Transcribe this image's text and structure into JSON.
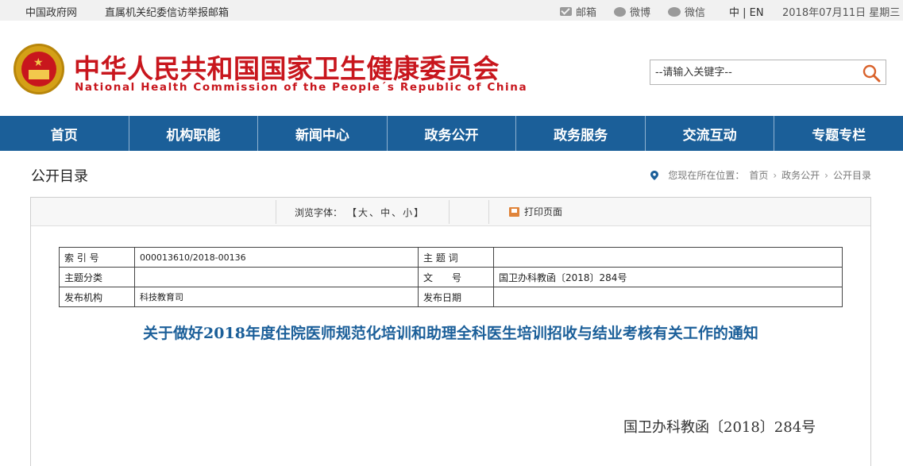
{
  "topbar": {
    "link_gov": "中国政府网",
    "link_report": "直属机关纪委信访举报邮箱",
    "mail": "邮箱",
    "weibo": "微博",
    "wechat": "微信",
    "lang": "中 | EN",
    "date": "2018年07月11日 星期三"
  },
  "header": {
    "title_cn": "中华人民共和国国家卫生健康委员会",
    "title_en": "National Health Commission of the People´s Republic of China",
    "search_placeholder": "--请输入关键字--"
  },
  "nav": {
    "items": [
      "首页",
      "机构职能",
      "新闻中心",
      "政务公开",
      "政务服务",
      "交流互动",
      "专题专栏"
    ]
  },
  "breadcrumb": {
    "page_title": "公开目录",
    "prefix": "您现在所在位置：",
    "crumbs": [
      "首页",
      "政务公开",
      "公开目录"
    ],
    "sep": "›"
  },
  "toolbar": {
    "font_label": "浏览字体：",
    "open_bracket": "【",
    "large": "大",
    "medium": "中",
    "small": "小",
    "close_bracket": "】",
    "dot": "、",
    "print": "打印页面"
  },
  "meta": {
    "index_label": "索 引 号",
    "index_value": "000013610/2018-00136",
    "keyword_label": "主 题 词",
    "keyword_value": "",
    "category_label": "主题分类",
    "category_value": "",
    "docno_label": "文　　号",
    "docno_value": "国卫办科教函〔2018〕284号",
    "org_label": "发布机构",
    "org_value": "科技教育司",
    "date_label": "发布日期",
    "date_value": ""
  },
  "document": {
    "title": "关于做好2018年度住院医师规范化培训和助理全科医生培训招收与结业考核有关工作的通知",
    "number": "国卫办科教函〔2018〕284号"
  }
}
